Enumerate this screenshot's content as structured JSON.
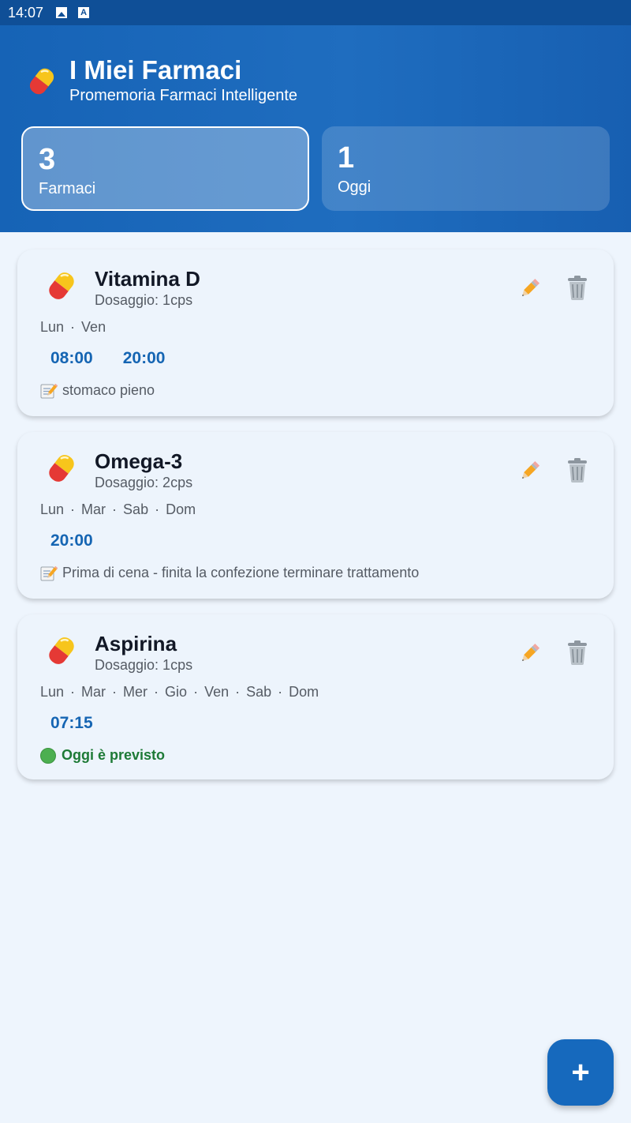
{
  "status_bar": {
    "time": "14:07",
    "icons": [
      "image-icon",
      "a-icon"
    ]
  },
  "header": {
    "title": "I Miei Farmaci",
    "subtitle": "Promemoria Farmaci Intelligente",
    "stats": [
      {
        "value": "3",
        "label": "Farmaci"
      },
      {
        "value": "1",
        "label": "Oggi"
      }
    ]
  },
  "medications": [
    {
      "name": "Vitamina D",
      "dose": "Dosaggio: 1cps",
      "days": [
        "Lun",
        "Ven"
      ],
      "times": [
        "08:00",
        "20:00"
      ],
      "note": "stomaco pieno"
    },
    {
      "name": "Omega-3",
      "dose": "Dosaggio: 2cps",
      "days": [
        "Lun",
        "Mar",
        "Sab",
        "Dom"
      ],
      "times": [
        "20:00"
      ],
      "note": "Prima di cena - finita la confezione terminare trattamento"
    },
    {
      "name": "Aspirina",
      "dose": "Dosaggio: 1cps",
      "days": [
        "Lun",
        "Mar",
        "Mer",
        "Gio",
        "Ven",
        "Sab",
        "Dom"
      ],
      "times": [
        "07:15"
      ],
      "status": "Oggi è previsto"
    }
  ],
  "fab": {
    "label": "+"
  },
  "colors": {
    "header": "#1a67b9",
    "accent": "#1565b3",
    "background": "#eef5fd",
    "ok": "#1d7a36"
  }
}
